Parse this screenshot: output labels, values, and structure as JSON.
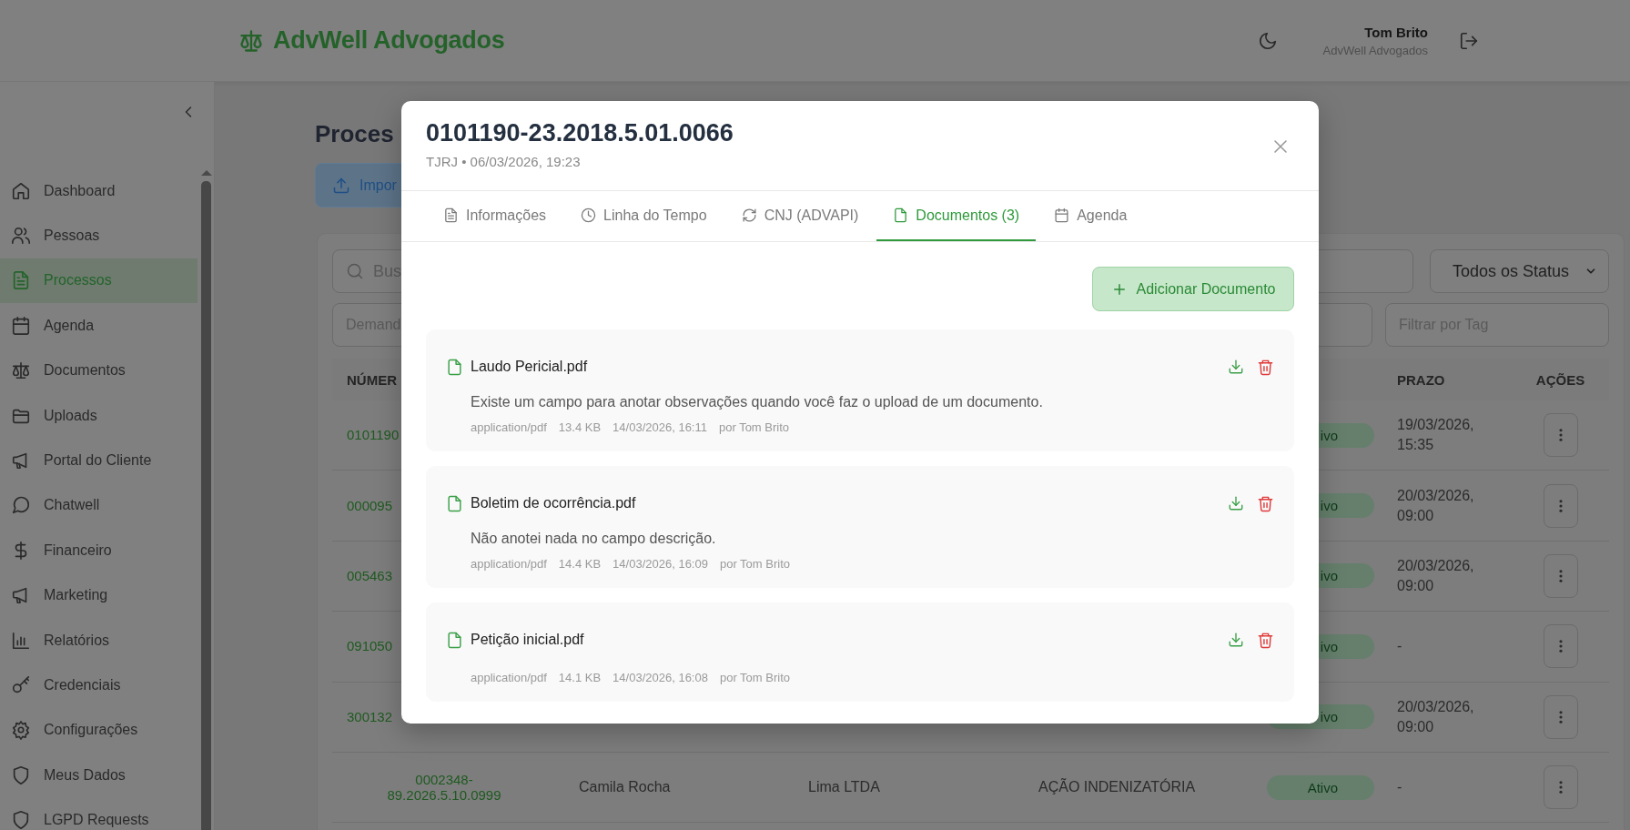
{
  "header": {
    "brand": "AdvWell Advogados",
    "user_name": "Tom Brito",
    "user_org": "AdvWell Advogados"
  },
  "sidebar": {
    "items": [
      {
        "label": "Dashboard",
        "selected": false
      },
      {
        "label": "Pessoas",
        "selected": false
      },
      {
        "label": "Processos",
        "selected": true
      },
      {
        "label": "Agenda",
        "selected": false
      },
      {
        "label": "Documentos",
        "selected": false
      },
      {
        "label": "Uploads",
        "selected": false
      },
      {
        "label": "Portal do Cliente",
        "selected": false
      },
      {
        "label": "Chatwell",
        "selected": false
      },
      {
        "label": "Financeiro",
        "selected": false
      },
      {
        "label": "Marketing",
        "selected": false
      },
      {
        "label": "Relatórios",
        "selected": false
      },
      {
        "label": "Credenciais",
        "selected": false
      },
      {
        "label": "Configurações",
        "selected": false
      },
      {
        "label": "Meus Dados",
        "selected": false
      },
      {
        "label": "LGPD Requests",
        "selected": false
      }
    ]
  },
  "page": {
    "title": "Proces",
    "import_button": "Impor",
    "search": {
      "placeholder": "Bus"
    },
    "status_select": {
      "value": "Todos os Status"
    },
    "field_2": {
      "placeholder": "Demand"
    },
    "tag_filter": {
      "placeholder": "Filtrar por Tag"
    }
  },
  "table": {
    "header": {
      "column_1": "NÚMER",
      "prazo": "PRAZO",
      "acoes": "AÇÕES"
    },
    "rows": [
      {
        "column_1": "0101190",
        "status": "ivo",
        "prazo": "19/03/2026, 15:35"
      },
      {
        "column_1": "000095",
        "status": "ivo",
        "prazo": "20/03/2026, 09:00"
      },
      {
        "column_1": "005463",
        "status": "ivo",
        "prazo": "20/03/2026, 09:00"
      },
      {
        "column_1": "091050",
        "status": "ivo",
        "prazo": "-"
      },
      {
        "column_1": "300132",
        "status": "ivo",
        "prazo": "20/03/2026, 09:00"
      },
      {
        "column_1": "0002348-89.2026.5.10.0999",
        "column_2": "Camila Rocha",
        "column_3": "Lima LTDA",
        "column_4": "AÇÃO INDENIZATÓRIA",
        "status": "Ativo",
        "prazo": "-"
      }
    ]
  },
  "modal": {
    "title": "0101190-23.2018.5.01.0066",
    "subtitle": "TJRJ • 06/03/2026, 19:23",
    "tabs": [
      {
        "label": "Informações",
        "selected": false
      },
      {
        "label": "Linha do Tempo",
        "selected": false
      },
      {
        "label": "CNJ (ADVAPI)",
        "selected": false
      },
      {
        "label": "Documentos (3)",
        "selected": true
      },
      {
        "label": "Agenda",
        "selected": false
      }
    ],
    "add_button": "Adicionar Documento",
    "documents": [
      {
        "name": "Laudo Pericial.pdf",
        "description": "Existe um campo para anotar observações quando você faz o upload de um documento.",
        "type": "application/pdf",
        "size": "13.4 KB",
        "date": "14/03/2026, 16:11",
        "author": "por Tom Brito"
      },
      {
        "name": "Boletim de ocorrência.pdf",
        "description": "Não anotei nada no campo descrição.",
        "type": "application/pdf",
        "size": "14.4 KB",
        "date": "14/03/2026, 16:09",
        "author": "por Tom Brito"
      },
      {
        "name": "Petição inicial.pdf",
        "type": "application/pdf",
        "size": "14.1 KB",
        "date": "14/03/2026, 16:08",
        "author": "por Tom Brito"
      }
    ]
  }
}
